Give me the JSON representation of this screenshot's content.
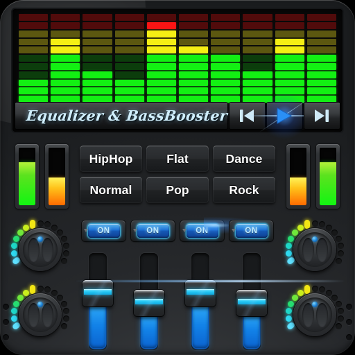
{
  "app": {
    "title": "Equalizer & BassBooster",
    "accent_blue": "#1f8fe8",
    "accent_cyan": "#22c6f3",
    "led_green": "#13f013",
    "led_yellow": "#f5ef14",
    "led_red": "#fc1414"
  },
  "spectrum": {
    "bars": 10,
    "segments_per_bar": 11,
    "zones": {
      "green": 6,
      "yellow": 3,
      "red": 2
    },
    "levels": [
      3,
      8,
      4,
      3,
      10,
      7,
      6,
      4,
      8,
      6
    ]
  },
  "transport": {
    "prev": {
      "name": "previous-track",
      "glyph": "|<"
    },
    "play": {
      "name": "play",
      "glyph": ">"
    },
    "next": {
      "name": "next-track",
      "glyph": ">|"
    }
  },
  "meters": [
    {
      "name": "meter-left-1",
      "color": "green",
      "level": 75
    },
    {
      "name": "meter-left-2",
      "color": "orange",
      "level": 48
    },
    {
      "name": "meter-right-1",
      "color": "orange",
      "level": 48
    },
    {
      "name": "meter-right-2",
      "color": "green",
      "level": 75
    }
  ],
  "presets": [
    {
      "label": "HipHop",
      "active": false
    },
    {
      "label": "Flat",
      "active": false
    },
    {
      "label": "Dance",
      "active": false
    },
    {
      "label": "Normal",
      "active": false
    },
    {
      "label": "Pop",
      "active": false
    },
    {
      "label": "Rock",
      "active": false
    }
  ],
  "switches": [
    {
      "label": "ON",
      "state": "on"
    },
    {
      "label": "ON",
      "state": "on"
    },
    {
      "label": "ON",
      "state": "on"
    },
    {
      "label": "ON",
      "state": "on"
    }
  ],
  "knobs": [
    {
      "name": "knob-top-left",
      "lit_leds": 7,
      "total_leds": 15
    },
    {
      "name": "knob-bottom-left",
      "lit_leds": 7,
      "total_leds": 15
    },
    {
      "name": "knob-top-right",
      "lit_leds": 7,
      "total_leds": 15
    },
    {
      "name": "knob-bottom-right",
      "lit_leds": 7,
      "total_leds": 15
    }
  ],
  "sliders": [
    {
      "name": "slider-1",
      "value": 62
    },
    {
      "name": "slider-2",
      "value": 48
    },
    {
      "name": "slider-3",
      "value": 62
    },
    {
      "name": "slider-4",
      "value": 48
    }
  ],
  "led_ring_colors": [
    "#5fe0ff",
    "#2fd9f0",
    "#1fd6c8",
    "#25dd72",
    "#6ee83c",
    "#c8ef1e",
    "#f2e614"
  ]
}
